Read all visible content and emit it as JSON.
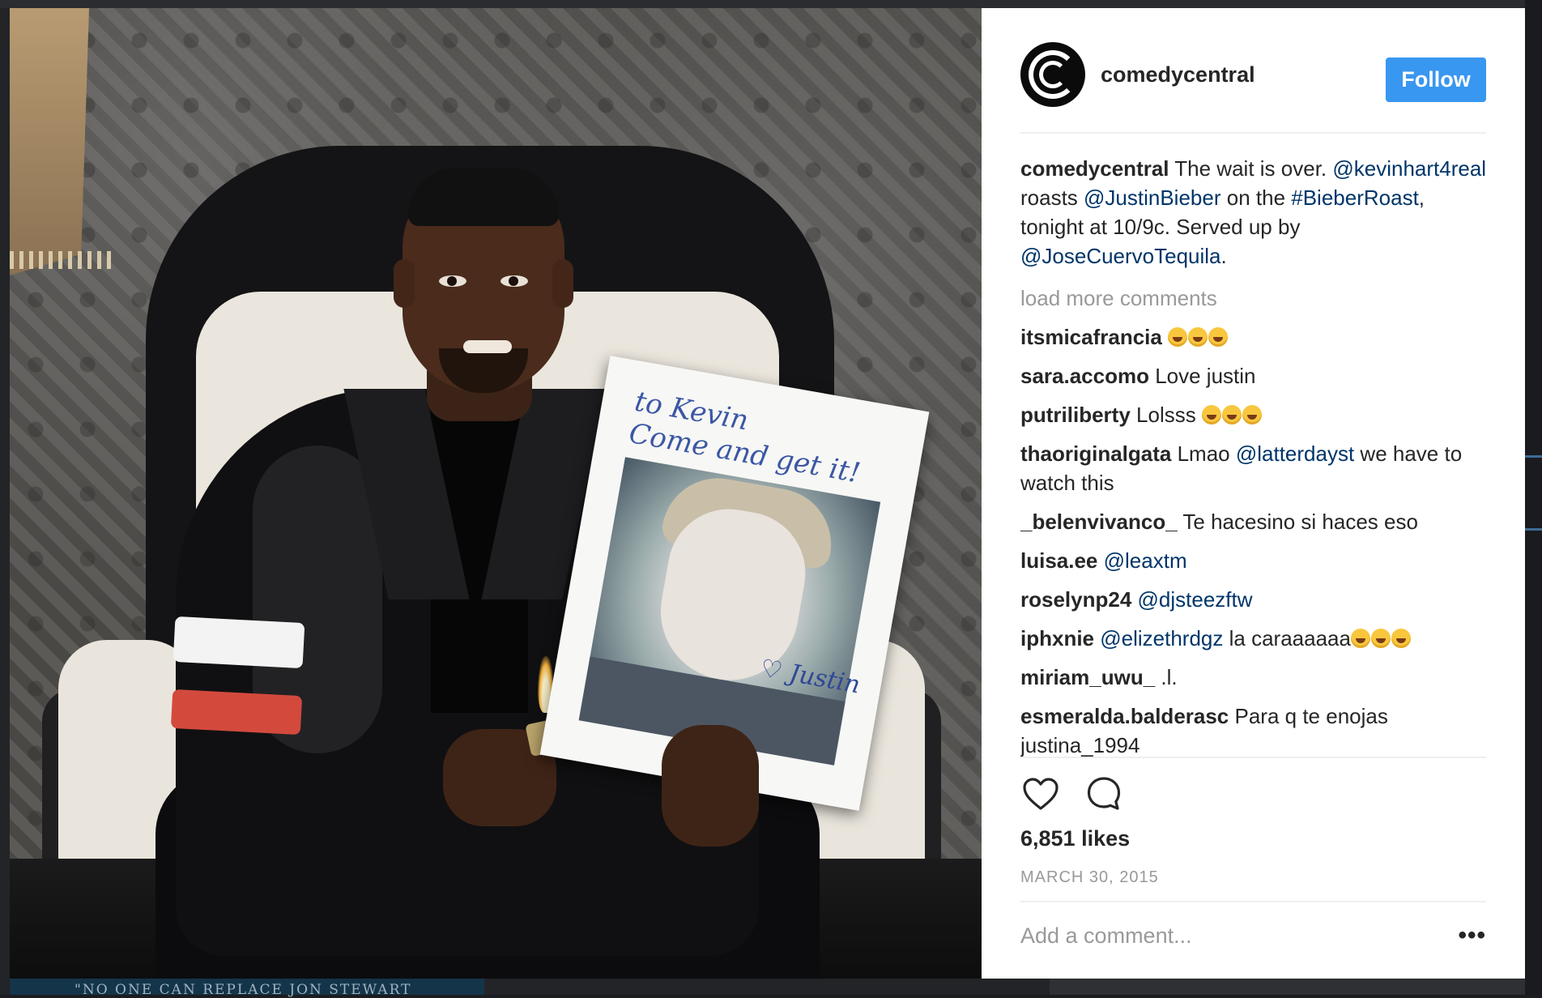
{
  "page": {
    "background_caption": "\"NO ONE CAN REPLACE JON STEWART"
  },
  "post": {
    "image_alt": "Kevin Hart holding Justin Bieber photo",
    "card_text": {
      "line1": "to Kevin",
      "line2": "Come and get it!",
      "signature": "♡ Justin"
    }
  },
  "header": {
    "username": "comedycentral",
    "follow_label": "Follow"
  },
  "caption": {
    "username": "comedycentral",
    "parts": [
      {
        "t": "text",
        "v": " The wait is over. "
      },
      {
        "t": "mention",
        "v": "@kevinhart4real"
      },
      {
        "t": "text",
        "v": " roasts "
      },
      {
        "t": "mention",
        "v": "@JustinBieber"
      },
      {
        "t": "text",
        "v": " on the "
      },
      {
        "t": "mention",
        "v": "#BieberRoast"
      },
      {
        "t": "text",
        "v": ", tonight at 10/9c. Served up by "
      },
      {
        "t": "mention",
        "v": "@JoseCuervoTequila"
      },
      {
        "t": "text",
        "v": "."
      }
    ]
  },
  "load_more": "load more comments",
  "comments": [
    {
      "user": "itsmicafrancia",
      "parts": [
        {
          "t": "emoji",
          "n": 3
        }
      ]
    },
    {
      "user": "sara.accomo",
      "parts": [
        {
          "t": "text",
          "v": " Love justin"
        }
      ]
    },
    {
      "user": "putriliberty",
      "parts": [
        {
          "t": "text",
          "v": " Lolsss "
        },
        {
          "t": "emoji",
          "n": 3
        }
      ]
    },
    {
      "user": "thaoriginalgata",
      "parts": [
        {
          "t": "text",
          "v": " Lmao "
        },
        {
          "t": "mention",
          "v": "@latterdayst"
        },
        {
          "t": "text",
          "v": " we have to watch this"
        }
      ]
    },
    {
      "user": "_belenvivanco_",
      "parts": [
        {
          "t": "text",
          "v": " Te hacesino si haces eso"
        }
      ]
    },
    {
      "user": "luisa.ee",
      "parts": [
        {
          "t": "text",
          "v": " "
        },
        {
          "t": "mention",
          "v": "@leaxtm"
        }
      ]
    },
    {
      "user": "roselynp24",
      "parts": [
        {
          "t": "text",
          "v": " "
        },
        {
          "t": "mention",
          "v": "@djsteezftw"
        }
      ]
    },
    {
      "user": "iphxnie",
      "parts": [
        {
          "t": "text",
          "v": " "
        },
        {
          "t": "mention",
          "v": "@elizethrdgz"
        },
        {
          "t": "text",
          "v": " la caraaaaaa"
        },
        {
          "t": "emoji",
          "n": 3
        }
      ]
    },
    {
      "user": "miriam_uwu_",
      "parts": [
        {
          "t": "text",
          "v": " .l."
        }
      ]
    },
    {
      "user": "esmeralda.balderasc",
      "parts": [
        {
          "t": "text",
          "v": " Para q te enojas justina_1994"
        }
      ]
    }
  ],
  "actions": {
    "like_icon": "heart-icon",
    "comment_icon": "speech-bubble-icon"
  },
  "likes": "6,851 likes",
  "date": "MARCH 30, 2015",
  "add_comment_placeholder": "Add a comment...",
  "more_label": "•••",
  "colors": {
    "follow_bg": "#3897f0",
    "mention": "#003569",
    "muted": "#999999",
    "text": "#262626"
  }
}
